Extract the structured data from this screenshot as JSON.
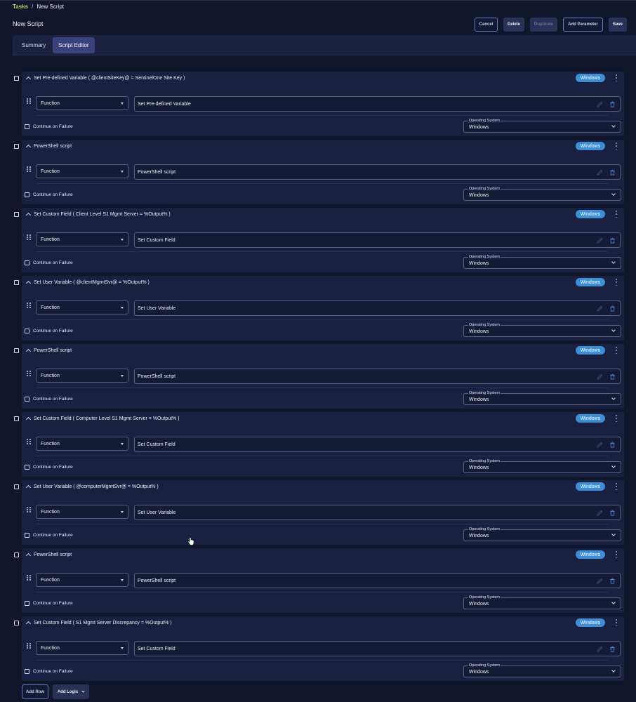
{
  "breadcrumb": {
    "root": "Tasks",
    "separator": "/",
    "current": "New Script"
  },
  "page": {
    "title": "New Script"
  },
  "toolbar": {
    "cancel": "Cancel",
    "delete": "Delete",
    "duplicate": "Duplicate",
    "add_parameter": "Add Parameter",
    "save": "Save"
  },
  "tabs": [
    {
      "label": "Summary",
      "active": false
    },
    {
      "label": "Script Editor",
      "active": true
    }
  ],
  "rows": [
    {
      "title": "Set Pre-defined Variable ( @clientSiteKey@ = SentinelOne Site Key )",
      "badge": "Windows",
      "type": "Function",
      "name": "Set Pre-defined Variable",
      "continue_label": "Continue on Failure",
      "os_label": "Operating System",
      "os_value": "Windows"
    },
    {
      "title": "PowerShell script",
      "badge": "Windows",
      "type": "Function",
      "name": "PowerShell script",
      "continue_label": "Continue on Failure",
      "os_label": "Operating System",
      "os_value": "Windows"
    },
    {
      "title": "Set Custom Field ( Client Level S1 Mgmt Server = %Output% )",
      "badge": "Windows",
      "type": "Function",
      "name": "Set Custom Field",
      "continue_label": "Continue on Failure",
      "os_label": "Operating System",
      "os_value": "Windows"
    },
    {
      "title": "Set User Variable ( @clientMgmtSvr@ = %Output% )",
      "badge": "Windows",
      "type": "Function",
      "name": "Set User Variable",
      "continue_label": "Continue on Failure",
      "os_label": "Operating System",
      "os_value": "Windows"
    },
    {
      "title": "PowerShell script",
      "badge": "Windows",
      "type": "Function",
      "name": "PowerShell script",
      "continue_label": "Continue on Failure",
      "os_label": "Operating System",
      "os_value": "Windows"
    },
    {
      "title": "Set Custom Field ( Computer Level S1 Mgmt Server = %Output% )",
      "badge": "Windows",
      "type": "Function",
      "name": "Set Custom Field",
      "continue_label": "Continue on Failure",
      "os_label": "Operating System",
      "os_value": "Windows"
    },
    {
      "title": "Set User Variable ( @computerMgmtSvr@ = %Output% )",
      "badge": "Windows",
      "type": "Function",
      "name": "Set User Variable",
      "continue_label": "Continue on Failure",
      "os_label": "Operating System",
      "os_value": "Windows"
    },
    {
      "title": "PowerShell script",
      "badge": "Windows",
      "type": "Function",
      "name": "PowerShell script",
      "continue_label": "Continue on Failure",
      "os_label": "Operating System",
      "os_value": "Windows"
    },
    {
      "title": "Set Custom Field ( S1 Mgmt Server Discrepancy = %Output% )",
      "badge": "Windows",
      "type": "Function",
      "name": "Set Custom Field",
      "continue_label": "Continue on Failure",
      "os_label": "Operating System",
      "os_value": "Windows"
    }
  ],
  "footer": {
    "add_row": "Add Row",
    "add_logic": "Add Logic"
  },
  "colors": {
    "background": "#11162b",
    "card": "#1a2040",
    "accent": "#3a8fd8",
    "breadcrumb_link": "#b9cf6d",
    "tab_active": "#39427a"
  }
}
